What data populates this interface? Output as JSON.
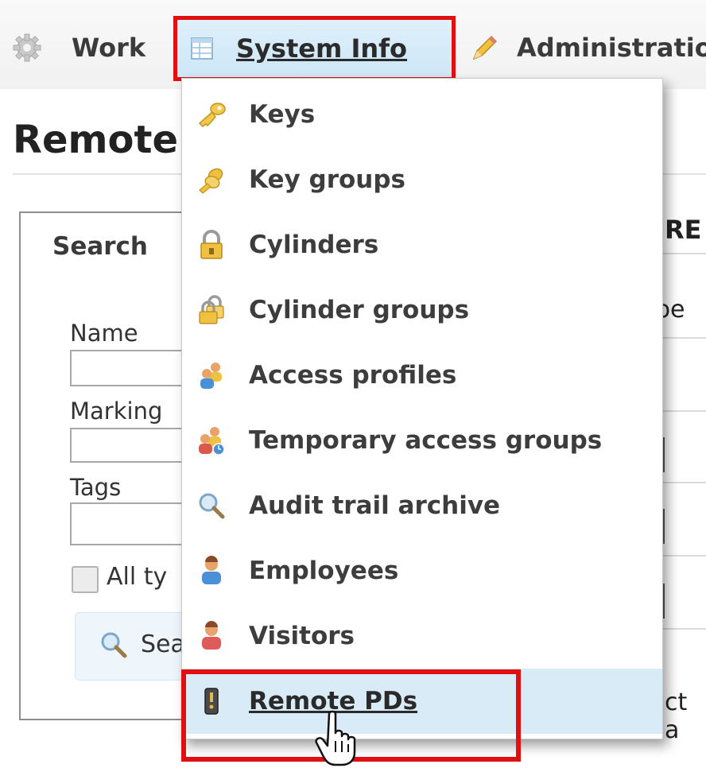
{
  "nav": {
    "work_label": "Work",
    "system_info_label": "System Info",
    "administration_label": "Administratio"
  },
  "page": {
    "title": "Remote"
  },
  "search_panel": {
    "heading": "Search",
    "name_label": "Name",
    "marking_label": "Marking",
    "tags_label": "Tags",
    "all_types_label": "All ty",
    "search_button_label": "Sea"
  },
  "right_column": {
    "header": "RE",
    "type_col": "pe",
    "bottom_text": "ct a"
  },
  "menu": {
    "items": [
      {
        "label": "Keys",
        "icon": "key-icon"
      },
      {
        "label": "Key groups",
        "icon": "key-group-icon"
      },
      {
        "label": "Cylinders",
        "icon": "padlock-icon"
      },
      {
        "label": "Cylinder groups",
        "icon": "padlock-group-icon"
      },
      {
        "label": "Access profiles",
        "icon": "access-profile-icon"
      },
      {
        "label": "Temporary access groups",
        "icon": "temporary-access-icon"
      },
      {
        "label": "Audit trail archive",
        "icon": "magnifier-icon"
      },
      {
        "label": "Employees",
        "icon": "employee-icon"
      },
      {
        "label": "Visitors",
        "icon": "visitor-icon"
      },
      {
        "label": "Remote PDs",
        "icon": "remote-pd-icon"
      }
    ],
    "active_item": "Remote PDs"
  },
  "colors": {
    "highlight_outline": "#e01010",
    "menu_active_bg": "#d8ebf6",
    "nav_active_bg": "#d6ebf8"
  }
}
